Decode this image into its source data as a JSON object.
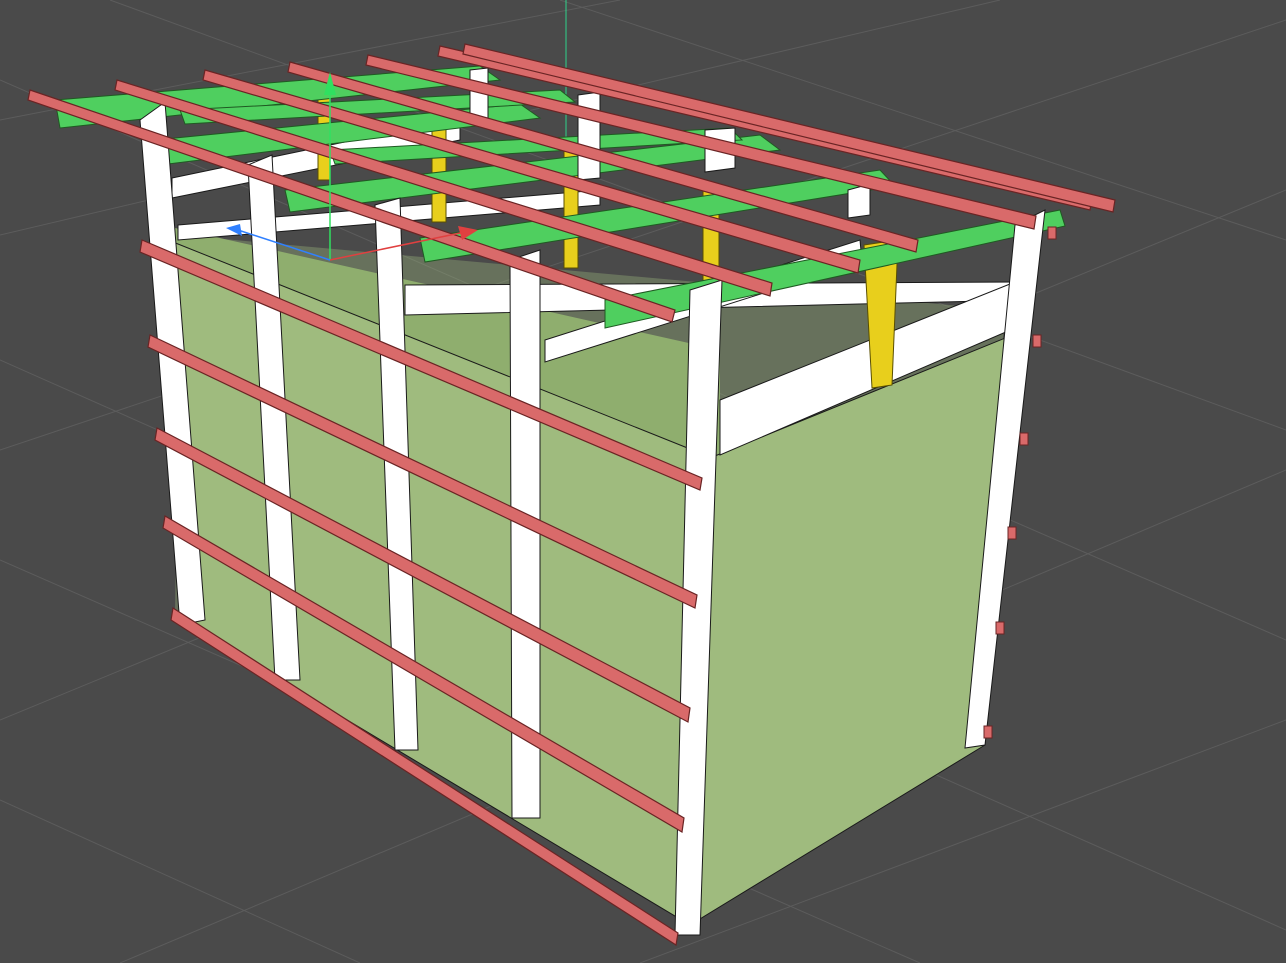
{
  "viewport": {
    "background_color": "#4a4a4a",
    "grid_color": "#5a5a5a",
    "colors": {
      "panel": "#9fbb7e",
      "panel_shadow": "#8aa96b",
      "stud": "#ffffff",
      "stud_edge": "#1a1a1a",
      "purlin": "#d96a6a",
      "purlin_edge": "#6a2424",
      "joist": "#4fcf5f",
      "joist_edge": "#1f5a22",
      "post": "#e8cf1c",
      "axis_x": "#e04040",
      "axis_y": "#30e060",
      "axis_z": "#3080ff"
    }
  }
}
